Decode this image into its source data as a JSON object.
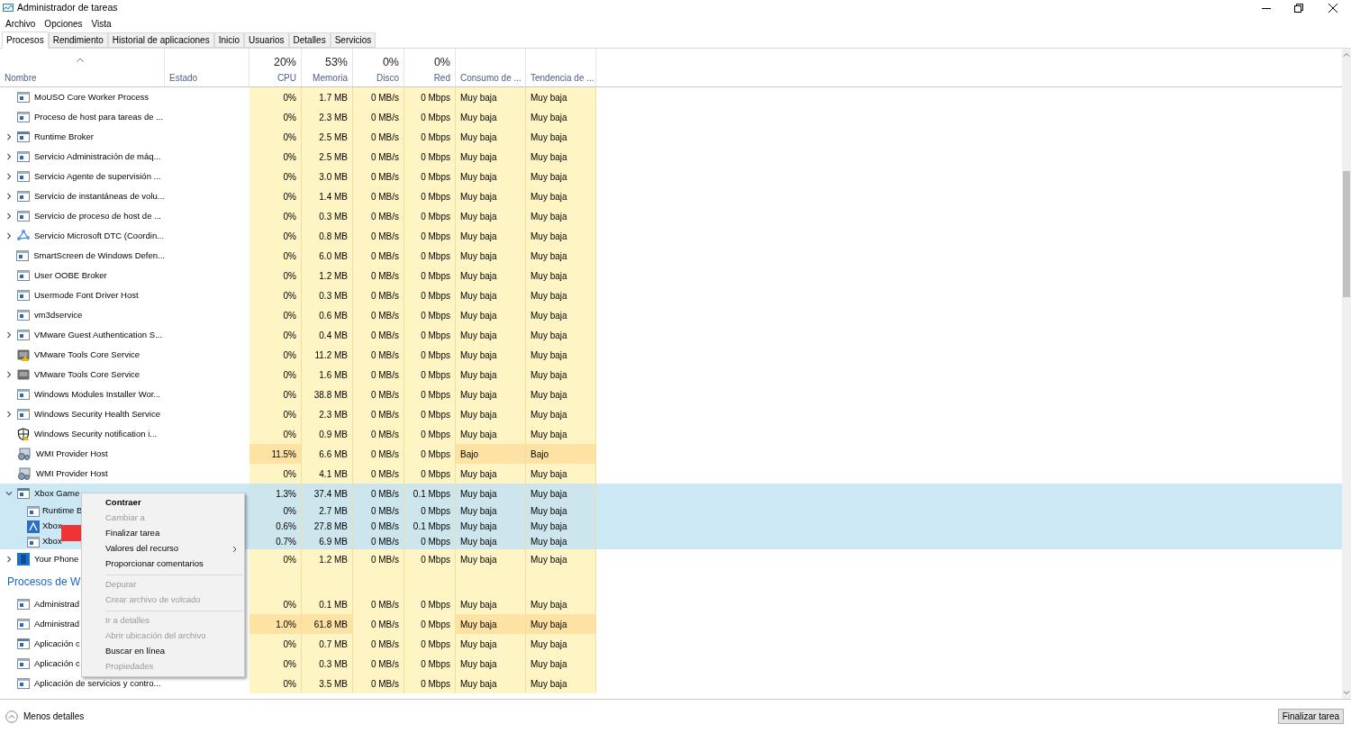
{
  "window": {
    "title": "Administrador de tareas"
  },
  "menu": [
    "Archivo",
    "Opciones",
    "Vista"
  ],
  "tabs": [
    {
      "label": "Procesos",
      "selected": true
    },
    {
      "label": "Rendimiento",
      "selected": false
    },
    {
      "label": "Historial de aplicaciones",
      "selected": false
    },
    {
      "label": "Inicio",
      "selected": false
    },
    {
      "label": "Usuarios",
      "selected": false
    },
    {
      "label": "Detalles",
      "selected": false
    },
    {
      "label": "Servicios",
      "selected": false
    }
  ],
  "table": {
    "columns": [
      {
        "label": "Nombre"
      },
      {
        "label": "Estado"
      },
      {
        "label": "CPU",
        "total": "20%"
      },
      {
        "label": "Memoria",
        "total": "53%"
      },
      {
        "label": "Disco",
        "total": "0%"
      },
      {
        "label": "Red",
        "total": "0%"
      },
      {
        "label": "Consumo de ..."
      },
      {
        "label": "Tendencia de ..."
      }
    ],
    "rows": [
      {
        "kind": "process",
        "name": "MoUSO Core Worker Process",
        "selected": false,
        "cpu_hot": false,
        "mem_hot": false,
        "cells": [
          "0%",
          "1.7 MB",
          "0 MB/s",
          "0 Mbps",
          "Muy baja",
          "Muy baja"
        ]
      },
      {
        "kind": "process",
        "name": "Proceso de host para tareas de ...",
        "selected": false,
        "cpu_hot": false,
        "mem_hot": false,
        "cells": [
          "0%",
          "2.3 MB",
          "0 MB/s",
          "0 Mbps",
          "Muy baja",
          "Muy baja"
        ]
      },
      {
        "kind": "process",
        "name": "Runtime Broker",
        "expanded": false,
        "selected": false,
        "cpu_hot": false,
        "mem_hot": false,
        "cells": [
          "0%",
          "2.5 MB",
          "0 MB/s",
          "0 Mbps",
          "Muy baja",
          "Muy baja"
        ]
      },
      {
        "kind": "process",
        "name": "Servicio Administración de máq...",
        "expanded": false,
        "selected": false,
        "cpu_hot": false,
        "mem_hot": false,
        "cells": [
          "0%",
          "2.5 MB",
          "0 MB/s",
          "0 Mbps",
          "Muy baja",
          "Muy baja"
        ]
      },
      {
        "kind": "process",
        "name": "Servicio Agente de supervisión ...",
        "expanded": false,
        "selected": false,
        "cpu_hot": false,
        "mem_hot": false,
        "cells": [
          "0%",
          "3.0 MB",
          "0 MB/s",
          "0 Mbps",
          "Muy baja",
          "Muy baja"
        ]
      },
      {
        "kind": "process",
        "name": "Servicio de instantáneas de volu...",
        "expanded": false,
        "selected": false,
        "cpu_hot": false,
        "mem_hot": false,
        "cells": [
          "0%",
          "1.4 MB",
          "0 MB/s",
          "0 Mbps",
          "Muy baja",
          "Muy baja"
        ]
      },
      {
        "kind": "process",
        "name": "Servicio de proceso de host de ...",
        "expanded": false,
        "selected": false,
        "cpu_hot": false,
        "mem_hot": false,
        "cells": [
          "0%",
          "0.3 MB",
          "0 MB/s",
          "0 Mbps",
          "Muy baja",
          "Muy baja"
        ]
      },
      {
        "kind": "process",
        "name": "Servicio Microsoft DTC (Coordin...",
        "expanded": false,
        "selected": false,
        "cpu_hot": false,
        "mem_hot": false,
        "cells": [
          "0%",
          "0.8 MB",
          "0 MB/s",
          "0 Mbps",
          "Muy baja",
          "Muy baja"
        ]
      },
      {
        "kind": "process",
        "name": "SmartScreen de Windows Defen...",
        "selected": false,
        "cpu_hot": false,
        "mem_hot": false,
        "cells": [
          "0%",
          "6.0 MB",
          "0 MB/s",
          "0 Mbps",
          "Muy baja",
          "Muy baja"
        ]
      },
      {
        "kind": "process",
        "name": "User OOBE Broker",
        "selected": false,
        "cpu_hot": false,
        "mem_hot": false,
        "cells": [
          "0%",
          "1.2 MB",
          "0 MB/s",
          "0 Mbps",
          "Muy baja",
          "Muy baja"
        ]
      },
      {
        "kind": "process",
        "name": "Usermode Font Driver Host",
        "selected": false,
        "cpu_hot": false,
        "mem_hot": false,
        "cells": [
          "0%",
          "0.3 MB",
          "0 MB/s",
          "0 Mbps",
          "Muy baja",
          "Muy baja"
        ]
      },
      {
        "kind": "process",
        "name": "vm3dservice",
        "selected": false,
        "cpu_hot": false,
        "mem_hot": false,
        "cells": [
          "0%",
          "0.6 MB",
          "0 MB/s",
          "0 Mbps",
          "Muy baja",
          "Muy baja"
        ]
      },
      {
        "kind": "process",
        "name": "VMware Guest Authentication S...",
        "expanded": false,
        "selected": false,
        "cpu_hot": false,
        "mem_hot": false,
        "cells": [
          "0%",
          "0.4 MB",
          "0 MB/s",
          "0 Mbps",
          "Muy baja",
          "Muy baja"
        ]
      },
      {
        "kind": "process",
        "name": "VMware Tools Core Service",
        "selected": false,
        "cpu_hot": false,
        "mem_hot": false,
        "cells": [
          "0%",
          "11.2 MB",
          "0 MB/s",
          "0 Mbps",
          "Muy baja",
          "Muy baja"
        ]
      },
      {
        "kind": "process",
        "name": "VMware Tools Core Service",
        "expanded": false,
        "selected": false,
        "cpu_hot": false,
        "mem_hot": false,
        "cells": [
          "0%",
          "1.6 MB",
          "0 MB/s",
          "0 Mbps",
          "Muy baja",
          "Muy baja"
        ]
      },
      {
        "kind": "process",
        "name": "Windows Modules Installer Wor...",
        "selected": false,
        "cpu_hot": false,
        "mem_hot": false,
        "cells": [
          "0%",
          "38.8 MB",
          "0 MB/s",
          "0 Mbps",
          "Muy baja",
          "Muy baja"
        ]
      },
      {
        "kind": "process",
        "name": "Windows Security Health Service",
        "expanded": false,
        "selected": false,
        "cpu_hot": false,
        "mem_hot": false,
        "cells": [
          "0%",
          "2.3 MB",
          "0 MB/s",
          "0 Mbps",
          "Muy baja",
          "Muy baja"
        ]
      },
      {
        "kind": "process",
        "name": "Windows Security notification i...",
        "selected": false,
        "cpu_hot": false,
        "mem_hot": false,
        "cells": [
          "0%",
          "0.9 MB",
          "0 MB/s",
          "0 Mbps",
          "Muy baja",
          "Muy baja"
        ]
      },
      {
        "kind": "process",
        "name": "WMI Provider Host",
        "selected": false,
        "cpu_hot": true,
        "mem_hot": false,
        "cells": [
          "11.5%",
          "6.6 MB",
          "0 MB/s",
          "0 Mbps",
          "Bajo",
          "Bajo"
        ]
      },
      {
        "kind": "process",
        "name": "WMI Provider Host",
        "selected": false,
        "cpu_hot": false,
        "mem_hot": false,
        "cells": [
          "0%",
          "4.1 MB",
          "0 MB/s",
          "0 Mbps",
          "Muy baja",
          "Muy baja"
        ]
      },
      {
        "kind": "process",
        "name": "Xbox Game",
        "expanded": true,
        "selected": true,
        "cpu_hot": false,
        "mem_hot": false,
        "cells": [
          "1.3%",
          "37.4 MB",
          "0 MB/s",
          "0.1 Mbps",
          "Muy baja",
          "Muy baja"
        ]
      },
      {
        "kind": "child",
        "name": "Runtime B",
        "selected": true,
        "cpu_hot": false,
        "mem_hot": false,
        "cells": [
          "0%",
          "2.7 MB",
          "0 MB/s",
          "0 Mbps",
          "Muy baja",
          "Muy baja"
        ]
      },
      {
        "kind": "child",
        "name": "Xbox",
        "selected": true,
        "cpu_hot": false,
        "mem_hot": false,
        "cells": [
          "0.6%",
          "27.8 MB",
          "0 MB/s",
          "0.1 Mbps",
          "Muy baja",
          "Muy baja"
        ]
      },
      {
        "kind": "child",
        "name": "Xbox",
        "selected": true,
        "cpu_hot": false,
        "mem_hot": false,
        "cells": [
          "0.7%",
          "6.9 MB",
          "0 MB/s",
          "0 Mbps",
          "Muy baja",
          "Muy baja"
        ]
      },
      {
        "kind": "process",
        "name": "Your Phone",
        "expanded": false,
        "selected": false,
        "cpu_hot": false,
        "mem_hot": false,
        "cells": [
          "0%",
          "1.2 MB",
          "0 MB/s",
          "0 Mbps",
          "Muy baja",
          "Muy baja"
        ]
      },
      {
        "kind": "section",
        "name": "Procesos de W"
      },
      {
        "kind": "process",
        "name": "Administrad",
        "selected": false,
        "cpu_hot": false,
        "mem_hot": false,
        "cells": [
          "0%",
          "0.1 MB",
          "0 MB/s",
          "0 Mbps",
          "Muy baja",
          "Muy baja"
        ]
      },
      {
        "kind": "process",
        "name": "Administrad",
        "selected": false,
        "cpu_hot": true,
        "mem_hot": true,
        "cells": [
          "1.0%",
          "61.8 MB",
          "0 MB/s",
          "0 Mbps",
          "Muy baja",
          "Muy baja"
        ]
      },
      {
        "kind": "process",
        "name": "Aplicación c",
        "selected": false,
        "cpu_hot": false,
        "mem_hot": false,
        "cells": [
          "0%",
          "0.7 MB",
          "0 MB/s",
          "0 Mbps",
          "Muy baja",
          "Muy baja"
        ]
      },
      {
        "kind": "process",
        "name": "Aplicación c",
        "selected": false,
        "cpu_hot": false,
        "mem_hot": false,
        "cells": [
          "0%",
          "0.3 MB",
          "0 MB/s",
          "0 Mbps",
          "Muy baja",
          "Muy baja"
        ]
      },
      {
        "kind": "process",
        "name": "Aplicación de servicios y contro...",
        "selected": false,
        "cpu_hot": false,
        "mem_hot": false,
        "cells": [
          "0%",
          "3.5 MB",
          "0 MB/s",
          "0 Mbps",
          "Muy baja",
          "Muy baja"
        ]
      }
    ]
  },
  "context_menu": [
    {
      "kind": "item",
      "label": "Contraer",
      "disabled": false,
      "default": true,
      "submenu": false
    },
    {
      "kind": "item",
      "label": "Cambiar a",
      "disabled": true,
      "default": false,
      "submenu": false
    },
    {
      "kind": "item",
      "label": "Finalizar tarea",
      "disabled": false,
      "default": false,
      "submenu": false
    },
    {
      "kind": "item",
      "label": "Valores del recurso",
      "disabled": false,
      "default": false,
      "submenu": true
    },
    {
      "kind": "item",
      "label": "Proporcionar comentarios",
      "disabled": false,
      "default": false,
      "submenu": false
    },
    {
      "kind": "separator"
    },
    {
      "kind": "item",
      "label": "Depurar",
      "disabled": true,
      "default": false,
      "submenu": false
    },
    {
      "kind": "item",
      "label": "Crear archivo de volcado",
      "disabled": true,
      "default": false,
      "submenu": false
    },
    {
      "kind": "separator"
    },
    {
      "kind": "item",
      "label": "Ir a detalles",
      "disabled": true,
      "default": false,
      "submenu": false
    },
    {
      "kind": "item",
      "label": "Abrir ubicación del archivo",
      "disabled": true,
      "default": false,
      "submenu": false
    },
    {
      "kind": "item",
      "label": "Buscar en línea",
      "disabled": false,
      "default": false,
      "submenu": false
    },
    {
      "kind": "item",
      "label": "Propiedades",
      "disabled": true,
      "default": false,
      "submenu": false
    }
  ],
  "footer": {
    "details_button": "Menos detalles",
    "end_task_button": "Finalizar tarea"
  }
}
